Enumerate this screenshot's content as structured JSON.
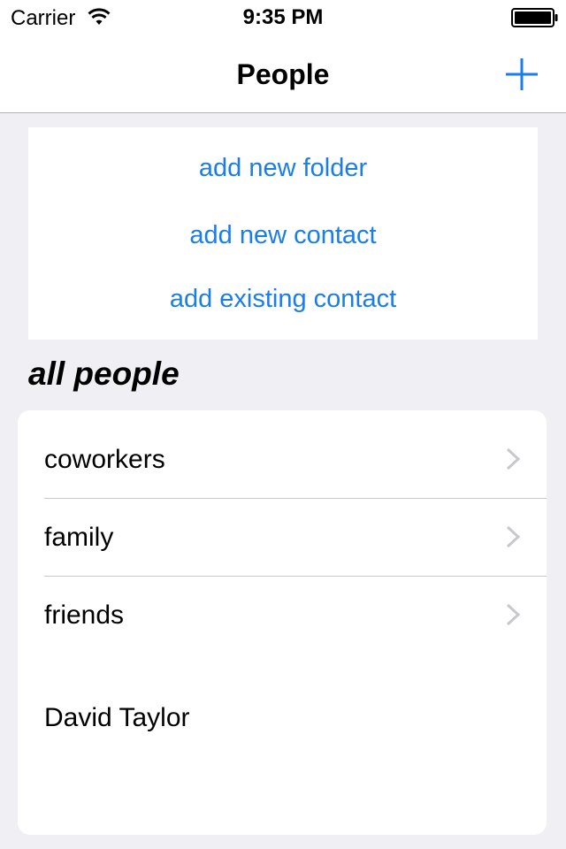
{
  "status_bar": {
    "carrier": "Carrier",
    "time": "9:35 PM",
    "icons": [
      "wifi-icon",
      "battery-icon"
    ]
  },
  "nav_bar": {
    "title": "People",
    "add_icon": "plus-icon"
  },
  "actions": {
    "add_folder": "add new folder",
    "add_contact": "add new contact",
    "add_existing": "add existing contact"
  },
  "section": {
    "title": "all people"
  },
  "folders": [
    {
      "label": "coworkers",
      "icon": "chevron-right-icon"
    },
    {
      "label": "family",
      "icon": "chevron-right-icon"
    },
    {
      "label": "friends",
      "icon": "chevron-right-icon"
    }
  ],
  "contacts": [
    {
      "name": "David Taylor"
    }
  ],
  "colors": {
    "accent": "#1a7ee8",
    "background": "#efeff4",
    "chevron": "#c7c7cc"
  }
}
